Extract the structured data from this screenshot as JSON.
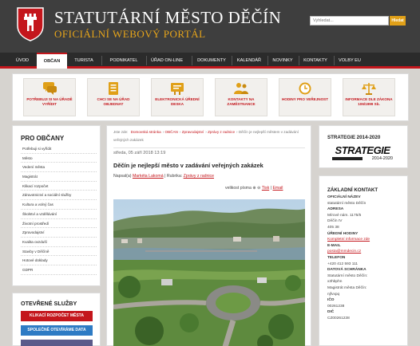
{
  "header": {
    "title": "STATUTÁRNÍ MĚSTO DĚČÍN",
    "subtitle": "OFICIÁLNÍ WEBOVÝ PORTÁL",
    "search_placeholder": "Vyhledat...",
    "search_button": "Hledat"
  },
  "nav": {
    "items": [
      "ÚVOD",
      "OBČAN",
      "TURISTA",
      "PODNIKATEL",
      "ÚŘAD ON-LINE",
      "DOKUMENTY",
      "KALENDÁŘ",
      "NOVINKY",
      "KONTAKTY",
      "VOLBY EU"
    ],
    "active": "OBČAN"
  },
  "quick_links": [
    {
      "label": "POTŘEBUJI SI NA ÚŘADĚ VYŘÍDIT",
      "icon": "speech-bubbles-icon"
    },
    {
      "label": "CHCI SE NA ÚŘAD OBJEDNAT",
      "icon": "document-list-icon"
    },
    {
      "label": "ELEKTRONICKÁ ÚŘEDNÍ DESKA",
      "icon": "notice-board-icon"
    },
    {
      "label": "KONTAKTY NA ZAMĚSTNANCE",
      "icon": "people-icon"
    },
    {
      "label": "HODINY PRO VEŘEJNOST",
      "icon": "clock-icon"
    },
    {
      "label": "INFORMACE DLE ZÁKONA 106/1999 Sb.",
      "icon": "scales-icon"
    }
  ],
  "left_sidebar": {
    "title": "PRO OBČANY",
    "items": [
      "Potřebuji si vyřídit",
      "Město",
      "Vedení města",
      "Magistrát",
      "Klikací rozpočet",
      "Zdravotnictví a sociální služby",
      "Kultura a volný čas",
      "Školství a vzdělávání",
      "Životní prostředí",
      "Zpravodajství",
      "Kvalita ovzduší",
      "Stavby v Děčíně",
      "Hotové doklady",
      "GDPR"
    ]
  },
  "services": {
    "title": "OTEVŘENÉ SLUŽBY",
    "buttons": [
      {
        "label": "KLIKACÍ ROZPOČET MĚSTA",
        "color": "#c4161c"
      },
      {
        "label": "SPOLEČNĚ OTEVÍRÁME DATA",
        "color": "#2e7bc4"
      },
      {
        "label": "",
        "color": "#5a5a8a"
      }
    ]
  },
  "article": {
    "breadcrumb_label": "Jste zde:",
    "breadcrumb": [
      "Domovská stránka",
      "OBČAN",
      "Zpravodajství",
      "Zprávy z radnice",
      "Děčín je nejlepší městem v zadávání veřejných zakázek"
    ],
    "date": "středa, 05 září 2018 13:19",
    "title": "Děčín je nejlepší město v zadávání veřejných zakázek",
    "author_label": "Napsal(a)",
    "author": "Markéta Lakomá",
    "category_label": "Rubrika:",
    "category": "Zprávy z radnice",
    "font_size_label": "velikost písma",
    "print_label": "Tisk",
    "email_label": "Email"
  },
  "strategy": {
    "title": "STRATEGIE 2014-2020",
    "logo_text": "STRATEGIE",
    "logo_years": "2014-2020"
  },
  "contact": {
    "title": "ZÁKLADNÍ KONTAKT",
    "lines": [
      {
        "text": "OFICIÁLNÍ NÁZEV",
        "kind": "h"
      },
      {
        "text": "statutární město Děčín",
        "kind": "t"
      },
      {
        "text": "ADRESA",
        "kind": "h"
      },
      {
        "text": "Mírové nám. 1175/5",
        "kind": "t"
      },
      {
        "text": "Děčín IV",
        "kind": "t"
      },
      {
        "text": "405 38",
        "kind": "t"
      },
      {
        "text": "ÚŘEDNÍ HODINY",
        "kind": "h"
      },
      {
        "text": "Kompletní informace zde",
        "kind": "lnk"
      },
      {
        "text": "E-MAIL",
        "kind": "h"
      },
      {
        "text": "posta@mmdecin.cz",
        "kind": "lnk"
      },
      {
        "text": "TELEFON",
        "kind": "h"
      },
      {
        "text": "+420 412 593 111",
        "kind": "t"
      },
      {
        "text": "DATOVÁ SCHRÁNKA",
        "kind": "h"
      },
      {
        "text": "Statutární město Děčín:",
        "kind": "t"
      },
      {
        "text": "x3hbphn",
        "kind": "t"
      },
      {
        "text": "Magistrát města Děčín:",
        "kind": "t"
      },
      {
        "text": "njfvxpq",
        "kind": "t"
      },
      {
        "text": "IČO",
        "kind": "h"
      },
      {
        "text": "00261238",
        "kind": "t"
      },
      {
        "text": "DIČ",
        "kind": "h"
      },
      {
        "text": "CZ00261238",
        "kind": "t"
      }
    ]
  },
  "colors": {
    "accent_red": "#c4161c",
    "accent_gold": "#e7a51a",
    "header_bg": "#3e3e3e",
    "nav_bg": "#2b2b2b"
  }
}
